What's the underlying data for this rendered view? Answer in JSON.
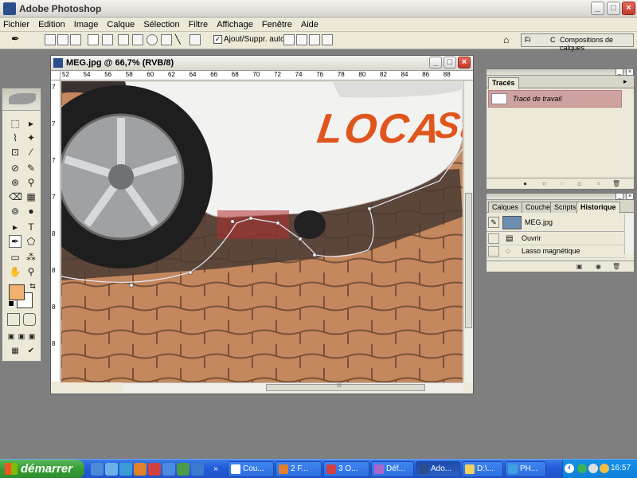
{
  "app": {
    "title": "Adobe Photoshop"
  },
  "window_buttons": {
    "minimize": "_",
    "maximize": "□",
    "close": "×"
  },
  "menu": [
    "Fichier",
    "Edition",
    "Image",
    "Calque",
    "Sélection",
    "Filtre",
    "Affichage",
    "Fenêtre",
    "Aide"
  ],
  "options_bar": {
    "auto_add_label": "Ajout/Suppr. auto",
    "auto_add_checked": true,
    "check_mark": "✓",
    "palette_well_tab1": "Fi",
    "palette_well_tab2": "C",
    "palette_well_label": "Compositions de calques"
  },
  "document": {
    "title": "MEG.jpg @ 66,7% (RVB/8)",
    "ruler_h": [
      "52",
      "54",
      "56",
      "58",
      "60",
      "62",
      "64",
      "66",
      "68",
      "70",
      "72",
      "74",
      "76",
      "78",
      "80",
      "82",
      "84",
      "86",
      "88"
    ],
    "ruler_v": [
      "7",
      "7",
      "7",
      "7",
      "8",
      "8",
      "8",
      "8"
    ],
    "banner_text": "LOCA",
    "banner_text2": "St",
    "hscroll_mark": "III"
  },
  "toolbox": {
    "tools": [
      "⬚",
      "▸",
      "⌇",
      "✦",
      "⊡",
      "⁄",
      "⊘",
      "✎",
      "⊛",
      "⚲",
      "⌫",
      "▦",
      "⊚",
      "●",
      "▸",
      "T",
      "✒",
      "⬠",
      "▭",
      "⁂",
      "✋",
      "⚲"
    ],
    "fg_color": "#f0b070",
    "bg_color": "#ffffff"
  },
  "paths_panel": {
    "tab": "Tracés",
    "item": "Tracé de travail",
    "footer_icons": [
      "●",
      "○",
      "◌",
      "⌂",
      "▫",
      "🗑"
    ]
  },
  "layers_panel": {
    "tabs": [
      "Calques",
      "Couches",
      "Scripts",
      "Historique"
    ],
    "active_tab": "Historique",
    "snapshot": "MEG.jpg",
    "history": [
      {
        "icon": "▤",
        "label": "Ouvrir"
      },
      {
        "icon": "◌",
        "label": "Lasso magnétique"
      }
    ],
    "footer_icons": [
      "▣",
      "◉",
      "🗑"
    ]
  },
  "taskbar": {
    "start_label": "démarrer",
    "quicklaunch_more": "»",
    "buttons": [
      {
        "label": "Cou...",
        "active": false
      },
      {
        "label": "2 F...",
        "active": false
      },
      {
        "label": "3 O...",
        "active": false
      },
      {
        "label": "Déf...",
        "active": false
      },
      {
        "label": "Ado...",
        "active": true
      },
      {
        "label": "D:\\...",
        "active": false
      },
      {
        "label": "PH...",
        "active": false
      }
    ],
    "tray_arrow": "‹",
    "clock": "16:57"
  }
}
